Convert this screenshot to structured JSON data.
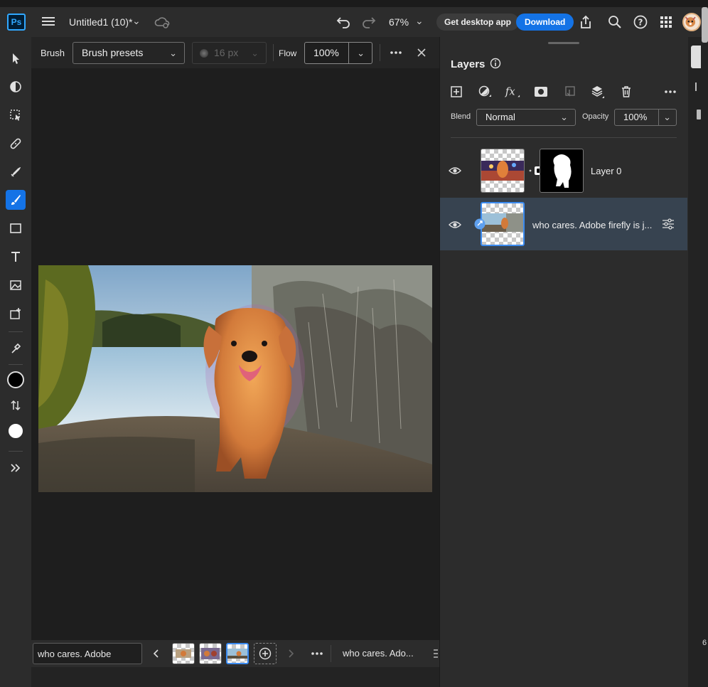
{
  "app": {
    "logo_text": "Ps"
  },
  "header": {
    "doc_title": "Untitled1 (10)*",
    "zoom": "67%",
    "get_desktop_label": "Get desktop app",
    "download_label": "Download"
  },
  "options": {
    "tool_name": "Brush",
    "presets_label": "Brush presets",
    "size_value": "16 px",
    "flow_label": "Flow",
    "flow_value": "100%"
  },
  "layers_panel": {
    "title": "Layers",
    "blend_label": "Blend",
    "blend_value": "Normal",
    "opacity_label": "Opacity",
    "opacity_value": "100%",
    "layers": [
      {
        "name": "Layer 0",
        "visible": true,
        "selected": false,
        "has_mask": true
      },
      {
        "name": "who cares. Adobe firefly is j...",
        "visible": true,
        "selected": true,
        "has_mask": false
      }
    ]
  },
  "doc_bar": {
    "active_tab": "who cares. Adobe fire...",
    "next_tab": "who cares. Ado..."
  },
  "edge": {
    "number": "6"
  },
  "colors": {
    "accent": "#1473e6",
    "foreground": "#000000",
    "background": "#ffffff",
    "selection": "#374350"
  }
}
